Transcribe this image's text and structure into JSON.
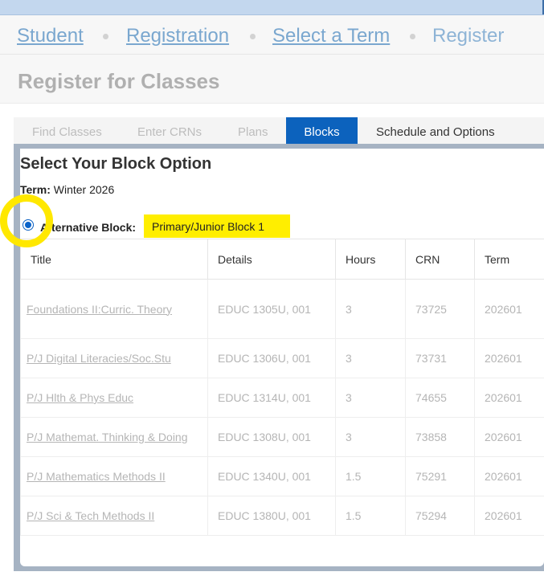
{
  "breadcrumb": {
    "items": [
      {
        "label": "Student"
      },
      {
        "label": "Registration"
      },
      {
        "label": "Select a Term"
      },
      {
        "label": "Register"
      }
    ]
  },
  "page": {
    "title": "Register for Classes"
  },
  "tabs": [
    {
      "label": "Find Classes"
    },
    {
      "label": "Enter CRNs"
    },
    {
      "label": "Plans"
    },
    {
      "label": "Blocks",
      "active": true
    },
    {
      "label": "Schedule and Options"
    }
  ],
  "block_option": {
    "heading": "Select Your Block Option",
    "term_label": "Term:",
    "term_value": "Winter 2026",
    "radio_label": "Alternative Block:",
    "block_name": "Primary/Junior Block 1"
  },
  "table": {
    "columns": [
      "Title",
      "Details",
      "Hours",
      "CRN",
      "Term"
    ],
    "rows": [
      {
        "title": "Foundations II:Curric. Theory",
        "details": "EDUC 1305U, 001",
        "hours": "3",
        "crn": "73725",
        "term": "202601"
      },
      {
        "title": "P/J Digital Literacies/Soc.Stu",
        "details": "EDUC 1306U, 001",
        "hours": "3",
        "crn": "73731",
        "term": "202601"
      },
      {
        "title": "P/J Hlth & Phys Educ",
        "details": "EDUC 1314U, 001",
        "hours": "3",
        "crn": "74655",
        "term": "202601"
      },
      {
        "title": "P/J Mathemat. Thinking & Doing",
        "details": "EDUC 1308U, 001",
        "hours": "3",
        "crn": "73858",
        "term": "202601"
      },
      {
        "title": "P/J Mathematics Methods II",
        "details": "EDUC 1340U, 001",
        "hours": "1.5",
        "crn": "75291",
        "term": "202601"
      },
      {
        "title": "P/J Sci & Tech Methods II",
        "details": "EDUC 1380U, 001",
        "hours": "1.5",
        "crn": "75294",
        "term": "202601"
      }
    ]
  },
  "colors": {
    "active_tab": "#0c62bd",
    "highlight": "#ffee00",
    "ring": "#ffe800"
  }
}
